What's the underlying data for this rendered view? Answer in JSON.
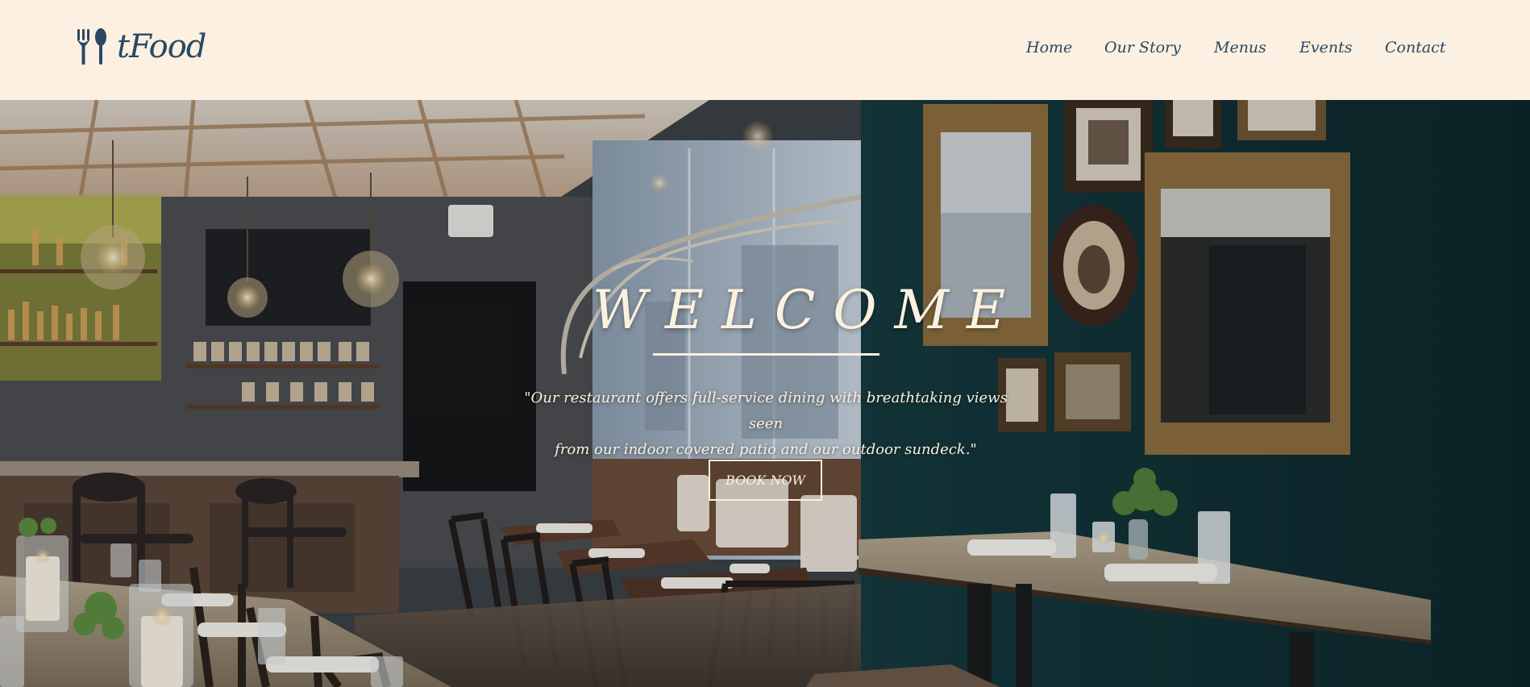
{
  "header": {
    "logo_text": "tFood",
    "logo_icon": "fork-spoon-icon",
    "nav": [
      {
        "label": "Home"
      },
      {
        "label": "Our Story"
      },
      {
        "label": "Menus"
      },
      {
        "label": "Events"
      },
      {
        "label": "Contact"
      }
    ]
  },
  "hero": {
    "title": "WELCOME",
    "tagline_line1": "\"Our restaurant offers full-service dining with breathtaking views seen",
    "tagline_line2": "from our indoor covered patio and our outdoor sundeck.\"",
    "button_label": "BOOK NOW",
    "background": "restaurant-interior-photo"
  },
  "colors": {
    "header_bg": "#fbf0e1",
    "brand": "#2b4861",
    "hero_text": "#fbf1df",
    "wall_teal": "#0f2f33"
  }
}
